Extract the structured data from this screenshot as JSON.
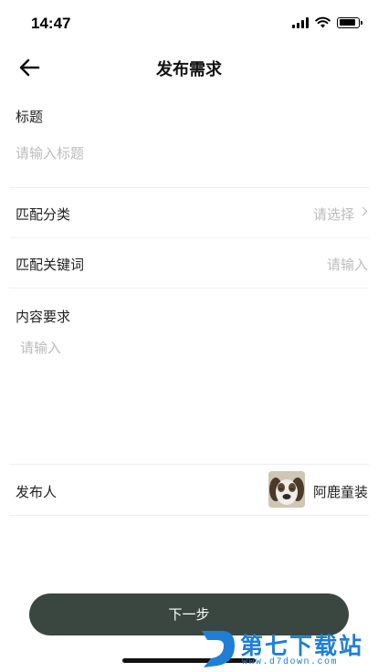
{
  "status_bar": {
    "time": "14:47",
    "signal_icon": "signal-icon",
    "wifi_icon": "wifi-icon",
    "battery_icon": "battery-icon"
  },
  "nav": {
    "back_icon": "arrow-left-icon",
    "title": "发布需求"
  },
  "form": {
    "title_label": "标题",
    "title_placeholder": "请输入标题",
    "category_label": "匹配分类",
    "category_placeholder": "请选择",
    "keyword_label": "匹配关键词",
    "keyword_placeholder": "请输入",
    "content_label": "内容要求",
    "content_placeholder": "请输入",
    "publisher_label": "发布人",
    "publisher_name": "阿鹿童装"
  },
  "footer": {
    "next_label": "下一步"
  },
  "watermark": {
    "title": "第七下载站",
    "url": "www.d7down.com"
  },
  "colors": {
    "button_bg": "#3a4741",
    "placeholder": "#bcbcbc",
    "watermark": "#1f7fd6"
  }
}
